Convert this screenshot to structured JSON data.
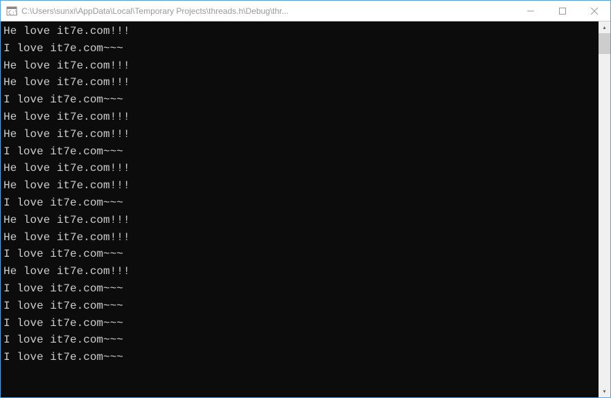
{
  "window": {
    "title": "C:\\Users\\sunxi\\AppData\\Local\\Temporary Projects\\threads.h\\Debug\\thr..."
  },
  "console": {
    "lines": [
      "He love it7e.com!!!",
      "I love it7e.com~~~",
      "He love it7e.com!!!",
      "He love it7e.com!!!",
      "I love it7e.com~~~",
      "He love it7e.com!!!",
      "He love it7e.com!!!",
      "I love it7e.com~~~",
      "He love it7e.com!!!",
      "He love it7e.com!!!",
      "I love it7e.com~~~",
      "He love it7e.com!!!",
      "He love it7e.com!!!",
      "I love it7e.com~~~",
      "He love it7e.com!!!",
      "I love it7e.com~~~",
      "I love it7e.com~~~",
      "I love it7e.com~~~",
      "I love it7e.com~~~",
      "I love it7e.com~~~"
    ]
  },
  "icons": {
    "minimize": "—",
    "maximize": "☐",
    "close": "✕",
    "arrow_up": "▴",
    "arrow_down": "▾"
  },
  "colors": {
    "console_bg": "#0c0c0c",
    "console_fg": "#cccccc",
    "titlebar_fg": "#999999",
    "border": "#5a9fd4"
  }
}
